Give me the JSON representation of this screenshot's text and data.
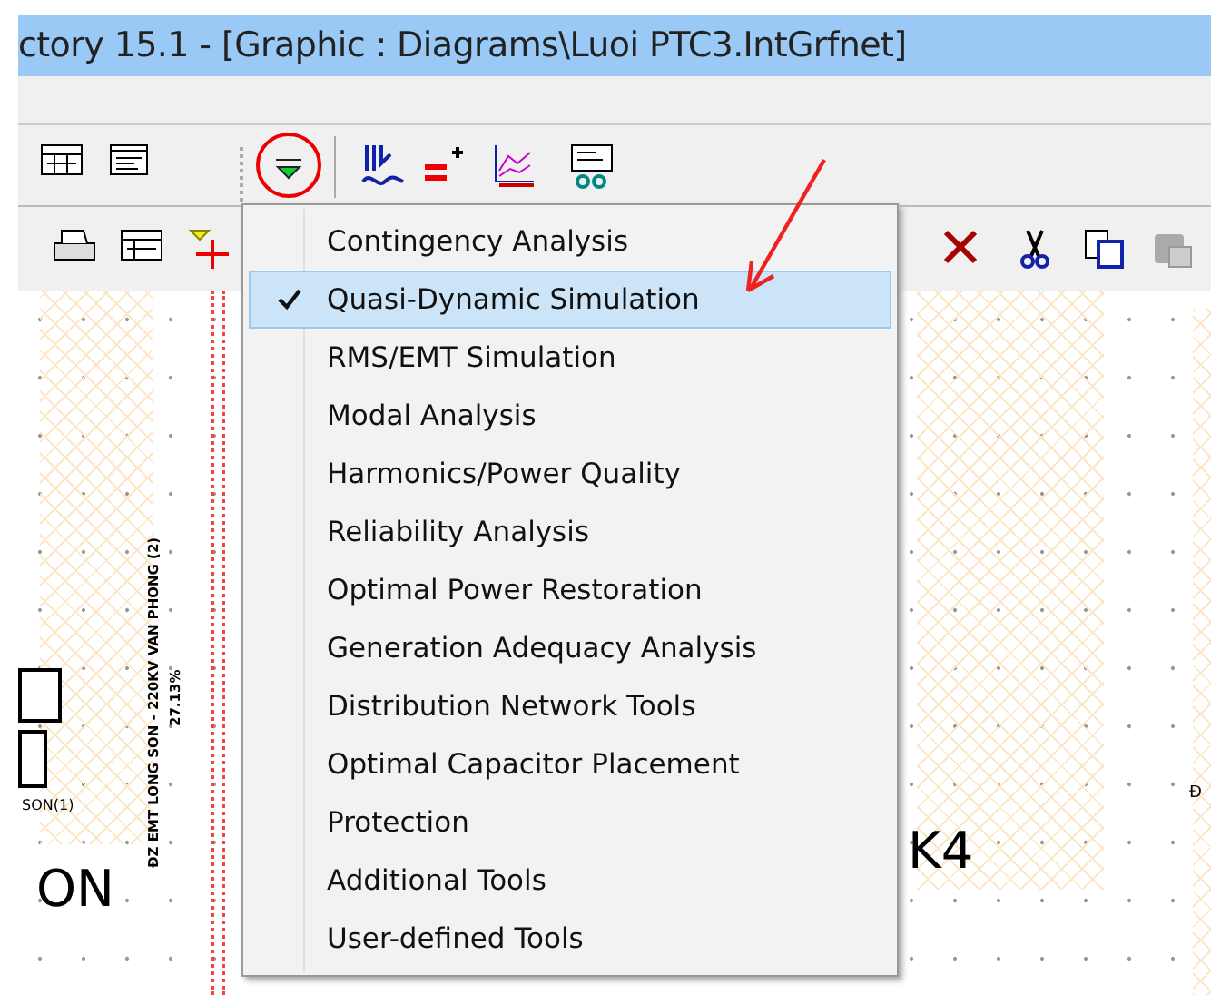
{
  "window": {
    "title": "ctory 15.1 - [Graphic : Diagrams\\Luoi PTC3.IntGrfnet]"
  },
  "menu": {
    "items": [
      {
        "label": "Contingency Analysis",
        "checked": false,
        "selected": false
      },
      {
        "label": "Quasi-Dynamic Simulation",
        "checked": true,
        "selected": true
      },
      {
        "label": "RMS/EMT Simulation",
        "checked": false,
        "selected": false
      },
      {
        "label": "Modal Analysis",
        "checked": false,
        "selected": false
      },
      {
        "label": "Harmonics/Power Quality",
        "checked": false,
        "selected": false
      },
      {
        "label": "Reliability Analysis",
        "checked": false,
        "selected": false
      },
      {
        "label": "Optimal Power Restoration",
        "checked": false,
        "selected": false
      },
      {
        "label": "Generation Adequacy Analysis",
        "checked": false,
        "selected": false
      },
      {
        "label": "Distribution Network Tools",
        "checked": false,
        "selected": false
      },
      {
        "label": "Optimal Capacitor Placement",
        "checked": false,
        "selected": false
      },
      {
        "label": "Protection",
        "checked": false,
        "selected": false
      },
      {
        "label": "Additional Tools",
        "checked": false,
        "selected": false
      },
      {
        "label": "User-defined Tools",
        "checked": false,
        "selected": false
      }
    ]
  },
  "canvas": {
    "line_label": "ĐZ EMT LONG SON - 220KV VAN PHONG (2)",
    "line_loading": "27.13%",
    "node_label": "SON(1)",
    "bus_left": "ON",
    "bus_right": "K4",
    "edge_label": "Đ"
  }
}
